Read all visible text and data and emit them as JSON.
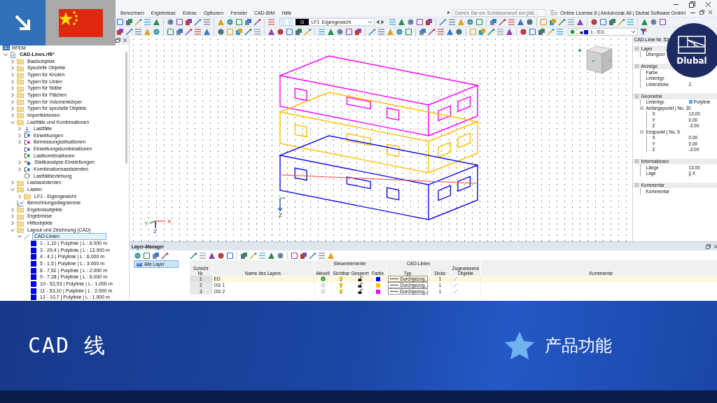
{
  "window": {
    "menu": [
      "Berechnen",
      "Ergebnisse",
      "Extras",
      "Optionen",
      "Fenster",
      "CAD-BIM",
      "Hilfe"
    ],
    "search": {
      "placeholder": "Geben Sie ein Schlüsselwort ein [Alt..."
    },
    "license": "Online License 6 | Abdulrzzak Ali | Dlubal Software GmbH"
  },
  "toolbar": {
    "load_case": {
      "type_badge": "G",
      "code": "LF1",
      "name": "Eigengewicht"
    },
    "layer_select": {
      "value": "1 - EG"
    }
  },
  "navigator": {
    "root": "RFEM",
    "items": [
      {
        "label": "CAD-Lines.rf6*",
        "kind": "project",
        "expanded": true,
        "selected": false,
        "children": [
          {
            "label": "Basisobjekte",
            "kind": "folder",
            "expanded": false,
            "selected": false
          },
          {
            "label": "Spezielle Objekte",
            "kind": "folder",
            "expanded": false,
            "selected": false
          },
          {
            "label": "Typen für Knoten",
            "kind": "folder",
            "expanded": false,
            "selected": false
          },
          {
            "label": "Typen für Linien",
            "kind": "folder",
            "expanded": false,
            "selected": false
          },
          {
            "label": "Typen für Stäbe",
            "kind": "folder",
            "expanded": false,
            "selected": false
          },
          {
            "label": "Typen für Flächen",
            "kind": "folder",
            "expanded": false,
            "selected": false
          },
          {
            "label": "Typen für Volumenkörper",
            "kind": "folder",
            "expanded": false,
            "selected": false
          },
          {
            "label": "Typen für spezielle Objekte",
            "kind": "folder",
            "expanded": false,
            "selected": false
          },
          {
            "label": "Imperfektionen",
            "kind": "folder",
            "expanded": false,
            "selected": false
          },
          {
            "label": "Lastfälle und Kombinationen",
            "kind": "folder",
            "expanded": true,
            "selected": false,
            "children": [
              {
                "label": "Lastfälle",
                "kind": "loadcases",
                "expanded": false,
                "selected": false
              },
              {
                "label": "Einwirkungen",
                "kind": "actions",
                "expanded": false,
                "selected": false
              },
              {
                "label": "Bemessungssituationen",
                "kind": "design",
                "expanded": false,
                "selected": false
              },
              {
                "label": "Einwirkungskombinationen",
                "kind": "actions",
                "selected": false
              },
              {
                "label": "Lastkombinationen",
                "kind": "loadcombo",
                "selected": false
              },
              {
                "label": "Statikanalyse-Einstellungen",
                "kind": "settings",
                "expanded": false,
                "selected": false
              },
              {
                "label": "Kombinationsassistenten",
                "kind": "actions",
                "expanded": false,
                "selected": false
              },
              {
                "label": "Lastfallbeziehung",
                "kind": "relation",
                "selected": false
              }
            ]
          },
          {
            "label": "Lastassistenten",
            "kind": "folder",
            "expanded": false,
            "selected": false
          },
          {
            "label": "Lasten",
            "kind": "folder",
            "expanded": true,
            "selected": false,
            "children": [
              {
                "label": "LF1 - Eigengewicht",
                "kind": "folder",
                "expanded": false,
                "selected": false
              }
            ]
          },
          {
            "label": "Berechnungsdiagramme",
            "kind": "diagram",
            "selected": false
          },
          {
            "label": "Ergebnisobjekte",
            "kind": "folder",
            "expanded": false,
            "selected": false
          },
          {
            "label": "Ergebnisse",
            "kind": "folder",
            "expanded": false,
            "selected": false
          },
          {
            "label": "Hilfsobjekte",
            "kind": "folder",
            "expanded": false,
            "selected": false
          },
          {
            "label": "Layout und Zeichnung (CAD)",
            "kind": "folder",
            "expanded": true,
            "selected": false,
            "children": [
              {
                "label": "CAD-Linien",
                "kind": "cadlines",
                "expanded": true,
                "selected": true,
                "children": [
                  {
                    "label": "1 - 1,10 | Polylinie | L : 6.000 m",
                    "kind": "cadline",
                    "selected": false
                  },
                  {
                    "label": "3 - 29,4 | Polylinie | L : 13.000 m",
                    "kind": "cadline",
                    "selected": false
                  },
                  {
                    "label": "4 - 4,1 | Polylinie | L : 6.000 m",
                    "kind": "cadline",
                    "selected": false
                  },
                  {
                    "label": "5 - 1,5 | Polylinie | L : 3.000 m",
                    "kind": "cadline",
                    "selected": false
                  },
                  {
                    "label": "8 - 7,52 | Polylinie | L : 2.000 m",
                    "kind": "cadline",
                    "selected": false
                  },
                  {
                    "label": "9 - 7,28 | Polylinie | L : 6.000 m",
                    "kind": "cadline",
                    "selected": false
                  },
                  {
                    "label": "10 - 52,53 | Polylinie | L : 1.000 m",
                    "kind": "cadline",
                    "selected": false
                  },
                  {
                    "label": "11 - 53,10 | Polylinie | L : 2.000 m",
                    "kind": "cadline",
                    "selected": false
                  },
                  {
                    "label": "12 - 10,7 | Polylinie | L : 1.000 m",
                    "kind": "cadline",
                    "selected": false
                  }
                ]
              }
            ]
          }
        ]
      }
    ]
  },
  "canvas": {
    "triad_labels": [
      "X",
      "Y",
      "Z"
    ],
    "origin_label": "Z"
  },
  "properties": {
    "title": "CAD-Linie Nr. 52",
    "sections": [
      {
        "label": "Layer",
        "expanded": true,
        "rows": [
          {
            "label": "Übergeor"
          }
        ]
      },
      {
        "label": "Anzeige",
        "expanded": true,
        "rows": [
          {
            "label": "Farbe"
          },
          {
            "label": "Linientyp"
          },
          {
            "label": "Liniendicke",
            "value": "2"
          }
        ]
      },
      {
        "label": "Geometrie",
        "expanded": true,
        "rows": [
          {
            "label": "Linientyp",
            "value": "Polylinie",
            "color": "#4da6f0"
          },
          {
            "label": "Anfangspunkt | No. 30",
            "expanded": true,
            "rows": [
              {
                "label": "X",
                "value": "13.00"
              },
              {
                "label": "Y",
                "value": "0.00"
              },
              {
                "label": "Z",
                "value": "-3.00"
              }
            ]
          },
          {
            "label": "Endpunkt | No. 5",
            "expanded": true,
            "rows": [
              {
                "label": "X",
                "value": "0.00"
              },
              {
                "label": "Y",
                "value": "0.00"
              },
              {
                "label": "Z",
                "value": "-3.00"
              }
            ]
          }
        ]
      },
      {
        "label": "Informationen",
        "expanded": true,
        "rows": [
          {
            "label": "Länge",
            "value": "13.00"
          },
          {
            "label": "Lage",
            "value": "|| X"
          }
        ]
      },
      {
        "label": "Kommentar",
        "expanded": true,
        "rows": [
          {
            "label": "Kommentar"
          }
        ]
      }
    ]
  },
  "layer_manager": {
    "title": "Layer-Manager",
    "groups": [
      {
        "label": "Alle Layer",
        "selected": true
      }
    ],
    "columns": [
      {
        "label": "Schicht Nr."
      },
      {
        "label": "Name des Layers"
      },
      {
        "group": "Steuerelemente",
        "columns": [
          "Aktuell",
          "Sichtbar",
          "Gesperrt",
          "Farbe"
        ]
      },
      {
        "group": "CAD-Linien",
        "columns": [
          "Typ",
          "Dicke"
        ]
      },
      {
        "label": "Zugewiesene Objekte"
      },
      {
        "label": "Kommentar"
      }
    ],
    "rows": [
      {
        "no": "1",
        "name": "EG",
        "current": true,
        "visible": true,
        "locked": false,
        "color": "#0000ff",
        "line_type": "Durchgezog...",
        "thickness": "1",
        "selected": true
      },
      {
        "no": "2",
        "name": "OG 1",
        "current": false,
        "visible": true,
        "locked": false,
        "color": "#ffc000",
        "line_type": "Durchgezog...",
        "thickness": "1",
        "selected": false
      },
      {
        "no": "3",
        "name": "OG 2",
        "current": false,
        "visible": true,
        "locked": false,
        "color": "#ff00ff",
        "line_type": "Durchgezog...",
        "thickness": "1",
        "selected": false
      }
    ]
  },
  "logo": {
    "text": "Dlubal"
  },
  "banner": {
    "title": "CAD 线",
    "tagline": "产品功能"
  }
}
